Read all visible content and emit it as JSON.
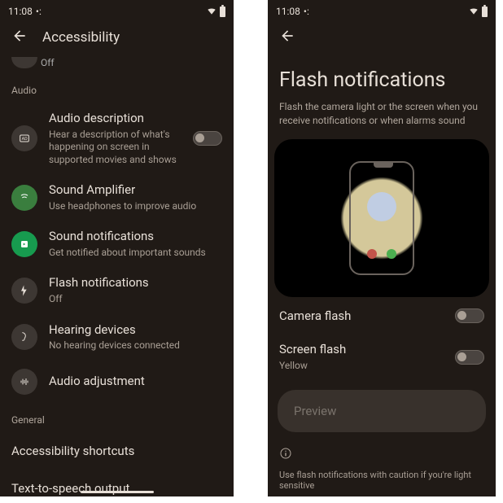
{
  "statusbar": {
    "time": "11:08"
  },
  "left": {
    "header_title": "Accessibility",
    "partial_sub": "Off",
    "section_audio": "Audio",
    "audio_desc": {
      "title": "Audio description",
      "sub": "Hear a description of what's happening on screen in supported movies and shows"
    },
    "sound_amp": {
      "title": "Sound Amplifier",
      "sub": "Use headphones to improve audio"
    },
    "sound_notif": {
      "title": "Sound notifications",
      "sub": "Get notified about important sounds"
    },
    "flash_notif": {
      "title": "Flash notifications",
      "sub": "Off"
    },
    "hearing": {
      "title": "Hearing devices",
      "sub": "No hearing devices connected"
    },
    "audio_adj": {
      "title": "Audio adjustment"
    },
    "section_general": "General",
    "shortcuts": "Accessibility shortcuts",
    "tts": "Text-to-speech output"
  },
  "right": {
    "title": "Flash notifications",
    "sub": "Flash the camera light or the screen when you receive notifications or when alarms sound",
    "camera_flash": "Camera flash",
    "screen_flash": {
      "title": "Screen flash",
      "sub": "Yellow"
    },
    "preview": "Preview",
    "caution": "Use flash notifications with caution if you're light sensitive"
  }
}
